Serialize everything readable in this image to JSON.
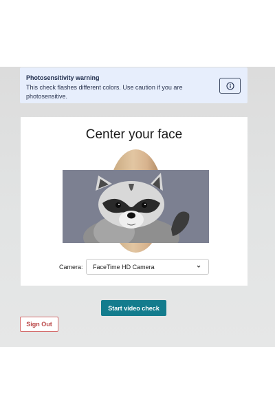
{
  "warning": {
    "title": "Photosensitivity warning",
    "text": "This check flashes different colors. Use caution if you are photosensitive.",
    "info_icon": "info-circle-icon"
  },
  "card": {
    "title": "Center your face",
    "camera_label": "Camera:",
    "camera_selected": "FaceTime HD Camera",
    "chevron_icon": "chevron-down-icon"
  },
  "actions": {
    "start_label": "Start video check",
    "signout_label": "Sign Out"
  },
  "colors": {
    "primary": "#137c8d",
    "danger": "#b94444",
    "warning_bg": "#e7eefc"
  }
}
